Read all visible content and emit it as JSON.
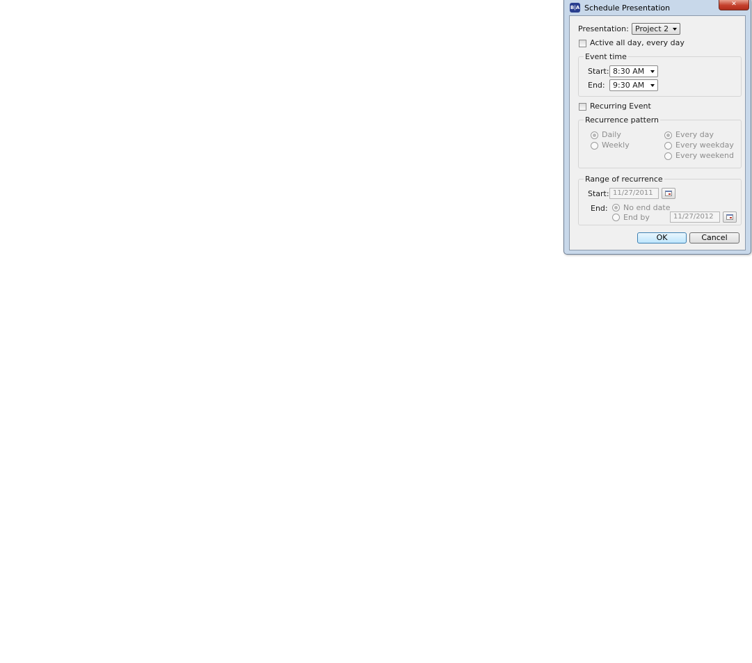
{
  "window": {
    "title": "Schedule Presentation",
    "app_icon_text": "B|A",
    "close_glyph": "✕"
  },
  "presentation": {
    "label": "Presentation:",
    "selected": "Project 2"
  },
  "active_all_day": {
    "label": "Active all day, every day",
    "checked": false
  },
  "event_time": {
    "legend": "Event time",
    "start_label": "Start:",
    "start_value": "8:30 AM",
    "end_label": "End:",
    "end_value": "9:30 AM"
  },
  "recurring": {
    "label": "Recurring Event",
    "checked": false
  },
  "recurrence_pattern": {
    "legend": "Recurrence pattern",
    "daily_label": "Daily",
    "weekly_label": "Weekly",
    "every_day_label": "Every day",
    "every_weekday_label": "Every weekday",
    "every_weekend_label": "Every weekend",
    "selected_frequency": "Daily",
    "selected_days": "Every day"
  },
  "range": {
    "legend": "Range of recurrence",
    "start_label": "Start:",
    "start_value": "11/27/2011",
    "end_label": "End:",
    "no_end_label": "No end date",
    "end_by_label": "End by",
    "end_by_value": "11/27/2012",
    "selected_end": "No end date"
  },
  "buttons": {
    "ok": "OK",
    "cancel": "Cancel"
  },
  "icons": {
    "app": "app-logo-icon",
    "close": "close-icon",
    "dropdown": "chevron-down-icon",
    "calendar": "calendar-icon"
  },
  "colors": {
    "titlebar": "#c8d8ea",
    "client": "#f0f0f0",
    "close_button": "#c4402c",
    "default_button": "#bee6fd"
  }
}
